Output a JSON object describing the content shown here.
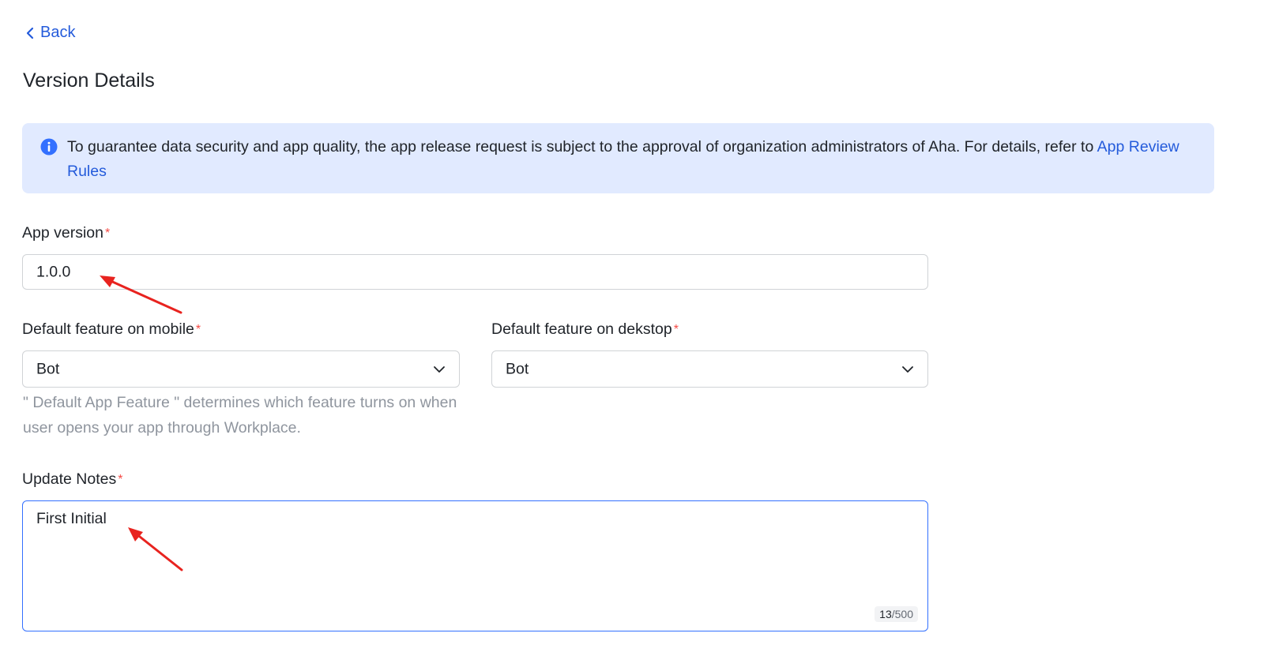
{
  "nav": {
    "back_label": "Back"
  },
  "page": {
    "title": "Version Details"
  },
  "notice": {
    "text": "To guarantee data security and app quality, the app release request is subject to the approval of organization administrators of Aha. For details, refer to ",
    "link_label": "App Review Rules",
    "icon": "info-icon"
  },
  "form": {
    "app_version": {
      "label": "App version",
      "required_mark": "*",
      "value": "1.0.0"
    },
    "default_mobile": {
      "label": "Default feature on mobile",
      "required_mark": "*",
      "value": "Bot"
    },
    "default_desktop": {
      "label": "Default feature on dekstop",
      "required_mark": "*",
      "value": "Bot"
    },
    "hint": "\" Default App Feature \" determines which feature turns on when user opens your app through Workplace.",
    "update_notes": {
      "label": "Update Notes",
      "required_mark": "*",
      "value": "First Initial",
      "count_current": "13",
      "count_max": "/500"
    }
  },
  "colors": {
    "accent": "#245bdb",
    "notice_bg": "#e1eaff",
    "required": "#f54a45",
    "annotation_arrow": "#e8231f",
    "focus_border": "#3370ff"
  }
}
